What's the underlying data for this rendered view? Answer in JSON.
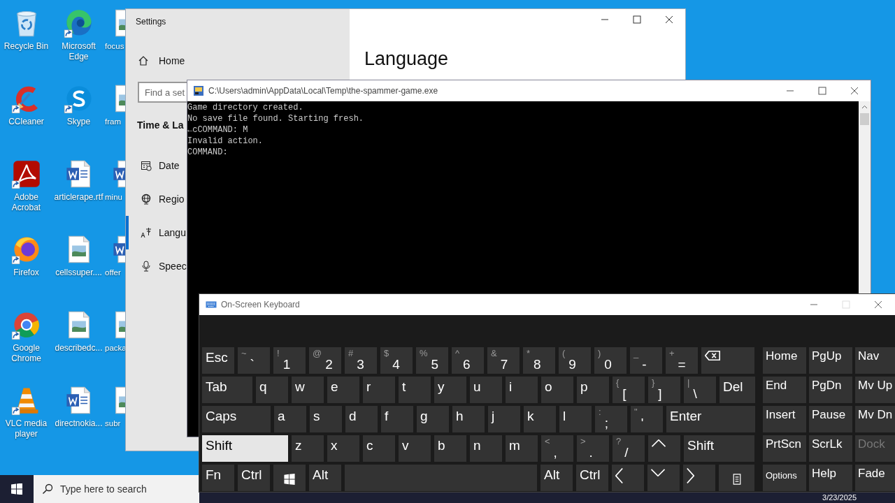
{
  "desktop": {
    "columns": [
      {
        "icons": [
          {
            "label": "Recycle Bin",
            "kind": "recycle-bin",
            "shortcut": false
          },
          {
            "label": "CCleaner",
            "kind": "broom",
            "shortcut": true
          },
          {
            "label": "Adobe Acrobat",
            "kind": "pdf",
            "shortcut": true
          },
          {
            "label": "Firefox",
            "kind": "firefox",
            "shortcut": true
          },
          {
            "label": "Google Chrome",
            "kind": "chrome",
            "shortcut": true
          },
          {
            "label": "VLC media player",
            "kind": "cone",
            "shortcut": true
          }
        ]
      },
      {
        "icons": [
          {
            "label": "Microsoft Edge",
            "kind": "edge",
            "shortcut": true
          },
          {
            "label": "Skype",
            "kind": "skype",
            "shortcut": true
          },
          {
            "label": "articlerape.rtf",
            "kind": "word",
            "shortcut": false
          },
          {
            "label": "cellssuper....",
            "kind": "image",
            "shortcut": false
          },
          {
            "label": "describedc...",
            "kind": "image",
            "shortcut": false
          },
          {
            "label": "directnokia...",
            "kind": "word",
            "shortcut": false
          }
        ]
      },
      {
        "icons": [
          {
            "label": "focus",
            "kind": "image",
            "shortcut": false
          },
          {
            "label": "fram",
            "kind": "image",
            "shortcut": false
          },
          {
            "label": "minu",
            "kind": "word",
            "shortcut": false
          },
          {
            "label": "offer",
            "kind": "word",
            "shortcut": false
          },
          {
            "label": "packa",
            "kind": "image",
            "shortcut": false
          },
          {
            "label": "subr",
            "kind": "image",
            "shortcut": false
          }
        ]
      }
    ]
  },
  "settings": {
    "title": "Settings",
    "home": "Home",
    "search": {
      "placeholder": "Find a set"
    },
    "section": "Time & La",
    "heading": "Language",
    "nav": [
      {
        "label": "Date",
        "kind": "date",
        "selected": false
      },
      {
        "label": "Regio",
        "kind": "region",
        "selected": false
      },
      {
        "label": "Langu",
        "kind": "language",
        "selected": true
      },
      {
        "label": "Speec",
        "kind": "speech",
        "selected": false
      }
    ]
  },
  "console": {
    "title": "C:\\Users\\admin\\AppData\\Local\\Temp\\the-spammer-game.exe",
    "lines": [
      "Game directory created.",
      "No save file found. Starting fresh.",
      "←cCOMMAND: M",
      "Invalid action.",
      "COMMAND:"
    ]
  },
  "keyboard": {
    "title": "On-Screen Keyboard",
    "rows": [
      {
        "keys": [
          {
            "kind": "text",
            "label": "Esc",
            "pressed": false
          },
          {
            "kind": "dual",
            "upper": "~",
            "lower": "`",
            "pressed": false
          },
          {
            "kind": "dual",
            "upper": "!",
            "lower": "1",
            "pressed": false
          },
          {
            "kind": "dual",
            "upper": "@",
            "lower": "2",
            "pressed": false
          },
          {
            "kind": "dual",
            "upper": "#",
            "lower": "3",
            "pressed": false
          },
          {
            "kind": "dual",
            "upper": "$",
            "lower": "4",
            "pressed": false
          },
          {
            "kind": "dual",
            "upper": "%",
            "lower": "5",
            "pressed": false
          },
          {
            "kind": "dual",
            "upper": "^",
            "lower": "6",
            "pressed": false
          },
          {
            "kind": "dual",
            "upper": "&",
            "lower": "7",
            "pressed": false
          },
          {
            "kind": "dual",
            "upper": "*",
            "lower": "8",
            "pressed": false
          },
          {
            "kind": "dual",
            "upper": "(",
            "lower": "9",
            "pressed": false
          },
          {
            "kind": "dual",
            "upper": ")",
            "lower": "0",
            "pressed": false
          },
          {
            "kind": "dual",
            "upper": "_",
            "lower": "-",
            "pressed": false
          },
          {
            "kind": "dual",
            "upper": "+",
            "lower": "=",
            "pressed": false
          },
          {
            "kind": "backspace",
            "pressed": false
          }
        ]
      },
      {
        "keys": [
          {
            "kind": "text",
            "label": "Tab",
            "pressed": false
          },
          {
            "kind": "text",
            "label": "q",
            "pressed": false
          },
          {
            "kind": "text",
            "label": "w",
            "pressed": false
          },
          {
            "kind": "text",
            "label": "e",
            "pressed": false
          },
          {
            "kind": "text",
            "label": "r",
            "pressed": false
          },
          {
            "kind": "text",
            "label": "t",
            "pressed": false
          },
          {
            "kind": "text",
            "label": "y",
            "pressed": false
          },
          {
            "kind": "text",
            "label": "u",
            "pressed": false
          },
          {
            "kind": "text",
            "label": "i",
            "pressed": false
          },
          {
            "kind": "text",
            "label": "o",
            "pressed": false
          },
          {
            "kind": "text",
            "label": "p",
            "pressed": false
          },
          {
            "kind": "dual",
            "upper": "{",
            "lower": "[",
            "pressed": false
          },
          {
            "kind": "dual",
            "upper": "}",
            "lower": "]",
            "pressed": false
          },
          {
            "kind": "dual",
            "upper": "|",
            "lower": "\\",
            "pressed": false
          },
          {
            "kind": "text",
            "label": "Del",
            "pressed": false
          }
        ]
      },
      {
        "keys": [
          {
            "kind": "text",
            "label": "Caps",
            "pressed": false
          },
          {
            "kind": "text",
            "label": "a",
            "pressed": false
          },
          {
            "kind": "text",
            "label": "s",
            "pressed": false
          },
          {
            "kind": "text",
            "label": "d",
            "pressed": false
          },
          {
            "kind": "text",
            "label": "f",
            "pressed": false
          },
          {
            "kind": "text",
            "label": "g",
            "pressed": false
          },
          {
            "kind": "text",
            "label": "h",
            "pressed": false
          },
          {
            "kind": "text",
            "label": "j",
            "pressed": false
          },
          {
            "kind": "text",
            "label": "k",
            "pressed": false
          },
          {
            "kind": "text",
            "label": "l",
            "pressed": false
          },
          {
            "kind": "dual",
            "upper": ":",
            "lower": ";",
            "pressed": false
          },
          {
            "kind": "dual",
            "upper": "\"",
            "lower": "'",
            "pressed": false
          },
          {
            "kind": "text",
            "label": "Enter",
            "pressed": false
          }
        ]
      },
      {
        "keys": [
          {
            "kind": "text",
            "label": "Shift",
            "pressed": true
          },
          {
            "kind": "text",
            "label": "z",
            "pressed": false
          },
          {
            "kind": "text",
            "label": "x",
            "pressed": false
          },
          {
            "kind": "text",
            "label": "c",
            "pressed": false
          },
          {
            "kind": "text",
            "label": "v",
            "pressed": false
          },
          {
            "kind": "text",
            "label": "b",
            "pressed": false
          },
          {
            "kind": "text",
            "label": "n",
            "pressed": false
          },
          {
            "kind": "text",
            "label": "m",
            "pressed": false
          },
          {
            "kind": "dual",
            "upper": "<",
            "lower": ",",
            "pressed": false
          },
          {
            "kind": "dual",
            "upper": ">",
            "lower": ".",
            "pressed": false
          },
          {
            "kind": "dual",
            "upper": "?",
            "lower": "/",
            "pressed": false
          },
          {
            "kind": "up",
            "pressed": false
          },
          {
            "kind": "text",
            "label": "Shift",
            "pressed": false
          }
        ]
      },
      {
        "keys": [
          {
            "kind": "text",
            "label": "Fn",
            "pressed": false
          },
          {
            "kind": "text",
            "label": "Ctrl",
            "pressed": false
          },
          {
            "kind": "windows",
            "pressed": false
          },
          {
            "kind": "text",
            "label": "Alt",
            "pressed": false
          },
          {
            "kind": "space",
            "pressed": false
          },
          {
            "kind": "text",
            "label": "Alt",
            "pressed": false
          },
          {
            "kind": "text",
            "label": "Ctrl",
            "pressed": false
          },
          {
            "kind": "left",
            "pressed": false
          },
          {
            "kind": "down",
            "pressed": false
          },
          {
            "kind": "right",
            "pressed": false
          },
          {
            "kind": "menu",
            "pressed": false
          }
        ]
      }
    ],
    "side_keys": [
      [
        {
          "kind": "text",
          "label": "Home",
          "disabled": false
        },
        {
          "kind": "text",
          "label": "PgUp",
          "disabled": false
        },
        {
          "kind": "text",
          "label": "Nav",
          "disabled": false
        }
      ],
      [
        {
          "kind": "text",
          "label": "End",
          "disabled": false
        },
        {
          "kind": "text",
          "label": "PgDn",
          "disabled": false
        },
        {
          "kind": "text",
          "label": "Mv Up",
          "disabled": false
        }
      ],
      [
        {
          "kind": "text",
          "label": "Insert",
          "disabled": false
        },
        {
          "kind": "text",
          "label": "Pause",
          "disabled": false
        },
        {
          "kind": "text",
          "label": "Mv Dn",
          "disabled": false
        }
      ],
      [
        {
          "kind": "text",
          "label": "PrtScn",
          "disabled": false
        },
        {
          "kind": "text",
          "label": "ScrLk",
          "disabled": false
        },
        {
          "kind": "text",
          "label": "Dock",
          "disabled": true
        }
      ],
      [
        {
          "kind": "small",
          "label": "Options",
          "disabled": false
        },
        {
          "kind": "text",
          "label": "Help",
          "disabled": false
        },
        {
          "kind": "text",
          "label": "Fade",
          "disabled": false
        }
      ]
    ]
  },
  "taskbar": {
    "search": {
      "placeholder": "Type here to search"
    },
    "date": "3/23/2025"
  }
}
